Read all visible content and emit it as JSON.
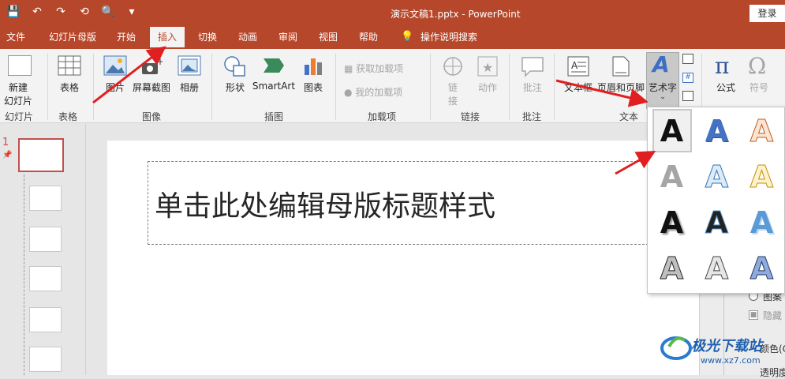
{
  "titlebar": {
    "qat": [
      "💾",
      "↶",
      "↷",
      "⟲",
      "🔍",
      "▾"
    ],
    "document_title": "演示文稿1.pptx  -  PowerPoint",
    "login": "登录"
  },
  "menu": {
    "tabs": [
      "文件",
      "幻灯片母版",
      "开始",
      "插入",
      "切换",
      "动画",
      "审阅",
      "视图",
      "帮助",
      "操作说明搜索"
    ],
    "active": "插入"
  },
  "ribbon": {
    "new_slide": [
      "新建",
      "幻灯片"
    ],
    "table": "表格",
    "picture": "图片",
    "screenshot": "屏幕截图",
    "album": "相册",
    "shapes": "形状",
    "smartart": "SmartArt",
    "chart": "图表",
    "get_addins": "获取加载项",
    "my_addins": "我的加载项",
    "link": [
      "链",
      "接"
    ],
    "action": "动作",
    "comment": "批注",
    "textbox": "文本框",
    "header_footer": "页眉和页脚",
    "wordart": "艺术字",
    "equation": "公式",
    "symbol": "符号",
    "groups": [
      "幻灯片",
      "表格",
      "图像",
      "插图",
      "加载项",
      "链接",
      "批注",
      "文本"
    ]
  },
  "slides": {
    "current_number": "1"
  },
  "slide": {
    "title_placeholder": "单击此处编辑母版标题样式"
  },
  "right_pane": {
    "option_pattern": "图案",
    "option_hide": "隐藏",
    "label_color": "颜色(C",
    "label_transparency": "透明度"
  },
  "watermark": {
    "text": "极光下载站",
    "url": "www.xz7.com"
  },
  "wordart_gallery": {
    "glyph": "A",
    "styles": [
      [
        "#111111",
        "#4472c4",
        "#ed7d31"
      ],
      [
        "#a5a5a5",
        "#5b9bd5",
        "#ffc000"
      ],
      [
        "#111111",
        "#222222",
        "#5b9bd5"
      ],
      [
        "#595959",
        "#7f7f7f",
        "#2f5597"
      ]
    ]
  },
  "colors": {
    "accent": "#b7472a",
    "annotation_arrow": "#e02020"
  }
}
